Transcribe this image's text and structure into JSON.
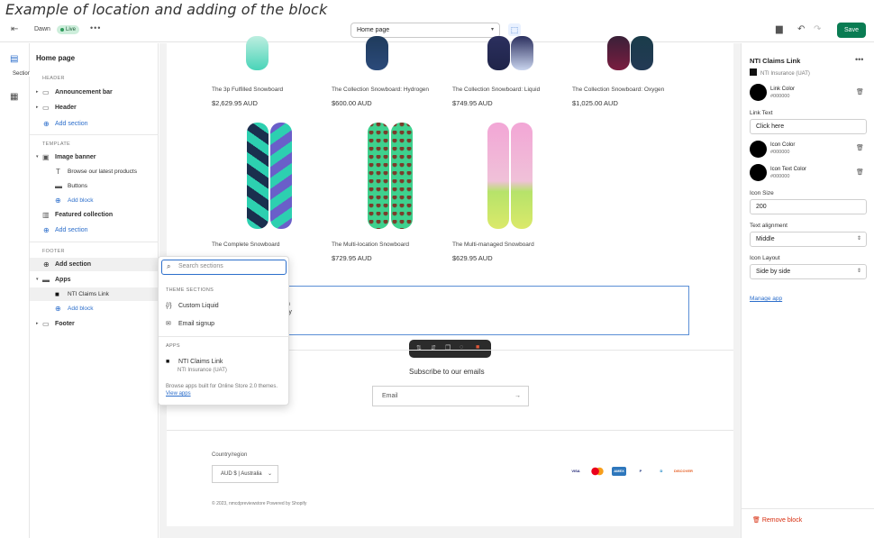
{
  "caption": "Example of location and adding of the block",
  "topbar": {
    "theme_name": "Dawn",
    "live_badge": "Live",
    "more": "•••",
    "page_select": "Home page",
    "save_label": "Save"
  },
  "rail": {
    "sections_tooltip": "Sections"
  },
  "left_panel": {
    "title": "Home page",
    "header_group": "HEADER",
    "announcement_bar": "Announcement bar",
    "header": "Header",
    "add_section_1": "Add section",
    "template_group": "TEMPLATE",
    "image_banner": "Image banner",
    "browse_products": "Browse our latest products",
    "buttons": "Buttons",
    "add_block_1": "Add block",
    "featured_collection": "Featured collection",
    "add_section_2": "Add section",
    "footer_group": "FOOTER",
    "add_section_3": "Add section",
    "apps": "Apps",
    "nti_claims_link": "NTI Claims Link",
    "add_block_2": "Add block",
    "footer": "Footer"
  },
  "products": [
    {
      "name": "The 3p Fulfilled Snowboard",
      "price": "$2,629.95 AUD"
    },
    {
      "name": "The Collection Snowboard: Hydrogen",
      "price": "$600.00 AUD"
    },
    {
      "name": "The Collection Snowboard: Liquid",
      "price": "$749.95 AUD"
    },
    {
      "name": "The Collection Snowboard: Oxygen",
      "price": "$1,025.00 AUD"
    },
    {
      "name": "The Complete Snowboard",
      "price": ""
    },
    {
      "name": "The Multi-location Snowboard",
      "price": "$729.95 AUD"
    },
    {
      "name": "The Multi-managed Snowboard",
      "price": "$629.95 AUD"
    }
  ],
  "selected_block": {
    "line1": "n",
    "line2": "ry"
  },
  "newsletter": {
    "title": "Subscribe to our emails",
    "email_placeholder": "Email",
    "submit_arrow": "→"
  },
  "footer": {
    "country_label": "Country/region",
    "country_value": "AUD $ | Australia",
    "copyright": "© 2023, nmcdpreviewstore Powered by Shopify",
    "payment_icons": [
      "VISA",
      "MC",
      "AMEX",
      "P",
      "D",
      "DISCOVER"
    ]
  },
  "popup": {
    "search_placeholder": "Search sections",
    "theme_sections_head": "THEME SECTIONS",
    "custom_liquid": "Custom Liquid",
    "email_signup": "Email signup",
    "apps_head": "APPS",
    "app_name": "NTI Claims Link",
    "app_vendor": "NTI Insurance (UAT)",
    "note": "Browse apps built for Online Store 2.0 themes.",
    "view_apps": "View apps"
  },
  "right_panel": {
    "title": "NTI Claims Link",
    "more": "•••",
    "app_vendor": "NTI Insurance (UAT)",
    "link_color_label": "Link Color",
    "link_color_hex": "#000000",
    "link_text_label": "Link Text",
    "link_text_value": "Click here",
    "icon_color_label": "Icon Color",
    "icon_color_hex": "#000000",
    "icon_text_color_label": "Icon Text Color",
    "icon_text_color_hex": "#000000",
    "icon_size_label": "Icon Size",
    "icon_size_value": "200",
    "text_alignment_label": "Text alignment",
    "text_alignment_value": "Middle",
    "icon_layout_label": "Icon Layout",
    "icon_layout_value": "Side by side",
    "manage_app": "Manage app",
    "remove_block": "Remove block"
  },
  "colors": {
    "accent": "#2c6ecb",
    "save": "#0a7c53",
    "danger": "#d72c0d"
  }
}
